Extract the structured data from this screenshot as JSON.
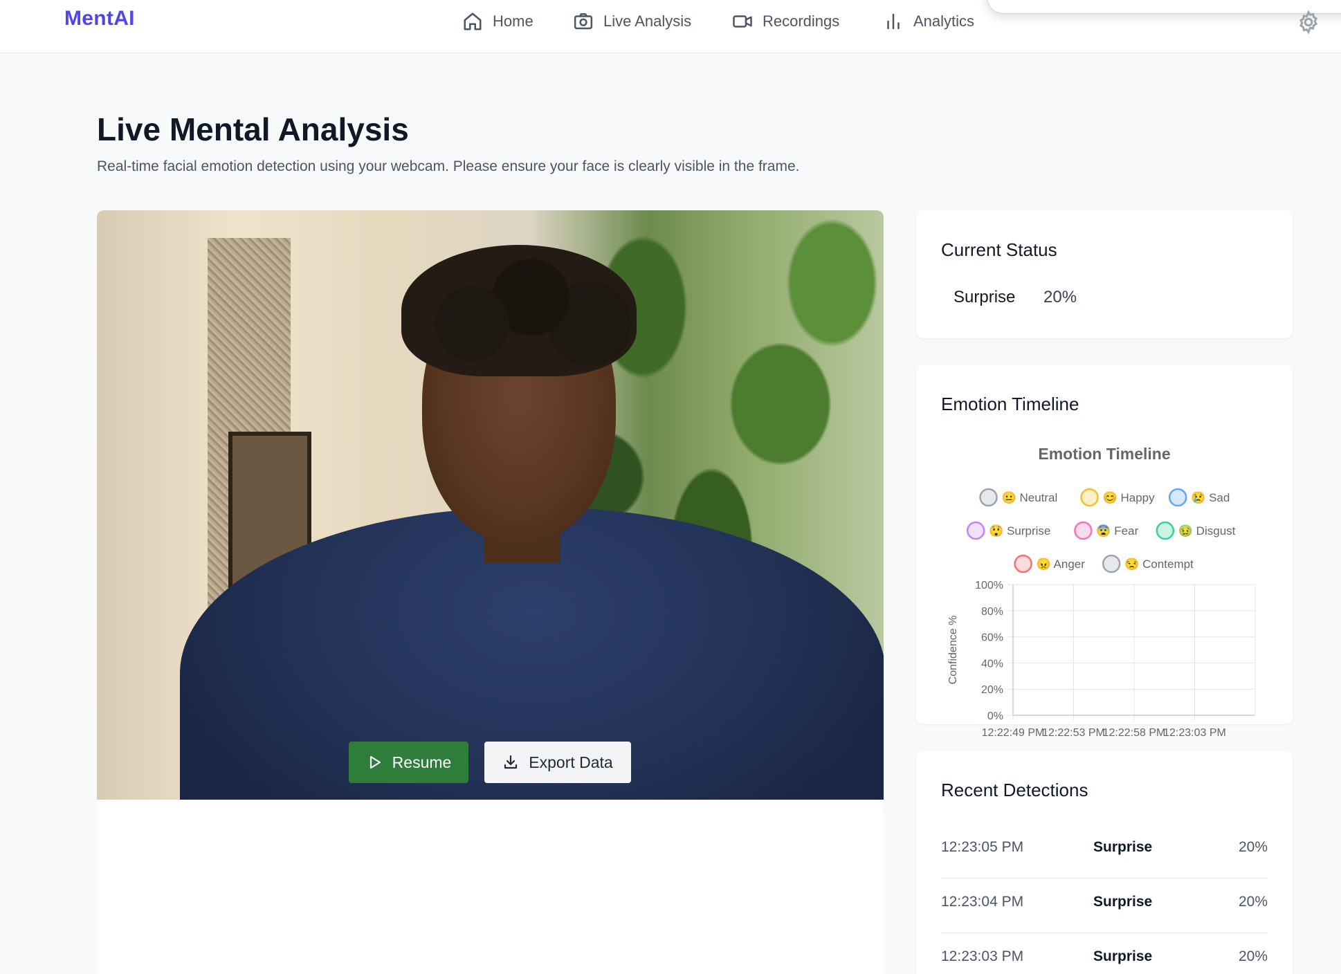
{
  "navbar": {
    "brand": "MentAI",
    "items": [
      {
        "label": "Home",
        "icon": "home-icon"
      },
      {
        "label": "Live Analysis",
        "icon": "camera-icon"
      },
      {
        "label": "Recordings",
        "icon": "video-icon"
      },
      {
        "label": "Analytics",
        "icon": "bar-chart-icon"
      }
    ],
    "settings_icon": "gear-icon"
  },
  "page": {
    "title": "Live Mental Analysis",
    "subtitle": "Real-time facial emotion detection using your webcam. Please ensure your face is clearly visible in the frame."
  },
  "controls": {
    "resume_label": "Resume",
    "export_label": "Export Data",
    "resume_color": "#2f7d3a"
  },
  "status": {
    "title": "Current Status",
    "emotion": "Surprise",
    "confidence": "20%"
  },
  "timeline": {
    "card_title": "Emotion Timeline"
  },
  "chart_data": {
    "type": "line",
    "title": "Emotion Timeline",
    "ylabel": "Confidence %",
    "xlabel": "",
    "ylim": [
      0,
      100
    ],
    "y_ticks": [
      "0%",
      "20%",
      "40%",
      "60%",
      "80%",
      "100%"
    ],
    "x": [
      "12:22:49 PM",
      "12:22:53 PM",
      "12:22:58 PM",
      "12:23:03 PM"
    ],
    "legend_position": "top",
    "grid": true,
    "series": [
      {
        "name": "😐 Neutral",
        "color": "#9ca3af",
        "values": []
      },
      {
        "name": "😊 Happy",
        "color": "#fbbf24",
        "values": []
      },
      {
        "name": "😢 Sad",
        "color": "#60a5fa",
        "values": []
      },
      {
        "name": "😲 Surprise",
        "color": "#c084fc",
        "values": []
      },
      {
        "name": "😨 Fear",
        "color": "#f472b6",
        "values": []
      },
      {
        "name": "🤢 Disgust",
        "color": "#34d399",
        "values": []
      },
      {
        "name": "😠 Anger",
        "color": "#f87171",
        "values": []
      },
      {
        "name": "😒 Contempt",
        "color": "#9ca3af",
        "values": []
      }
    ]
  },
  "recent": {
    "title": "Recent Detections",
    "rows": [
      {
        "time": "12:23:05 PM",
        "emotion": "Surprise",
        "confidence": "20%"
      },
      {
        "time": "12:23:04 PM",
        "emotion": "Surprise",
        "confidence": "20%"
      },
      {
        "time": "12:23:03 PM",
        "emotion": "Surprise",
        "confidence": "20%"
      }
    ]
  }
}
